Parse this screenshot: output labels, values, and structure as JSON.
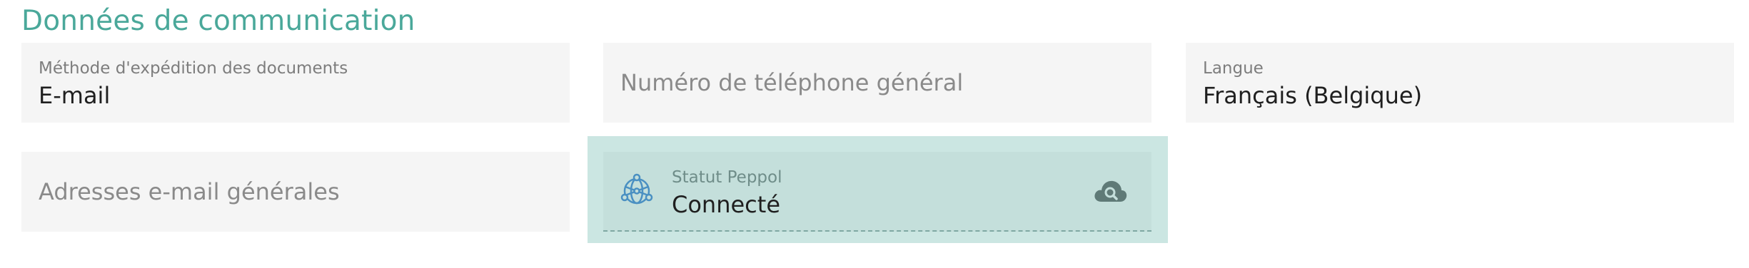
{
  "section": {
    "title": "Données de communication"
  },
  "fields": {
    "shipping_method": {
      "label": "Méthode d'expédition des documents",
      "value": "E-mail"
    },
    "phone": {
      "placeholder": "Numéro de téléphone général"
    },
    "language": {
      "label": "Langue",
      "value": "Français (Belgique)"
    },
    "emails": {
      "placeholder": "Adresses e-mail générales"
    },
    "peppol": {
      "label": "Statut Peppol",
      "value": "Connecté"
    }
  },
  "icons": {
    "peppol_globe": "globe-network-icon",
    "peppol_lookup": "cloud-search-icon"
  },
  "colors": {
    "accent": "#4aa89a",
    "field_bg": "#f5f5f5",
    "peppol_highlight": "#cbe6e2",
    "globe": "#4a90c2",
    "cloud": "#5f7a77"
  }
}
